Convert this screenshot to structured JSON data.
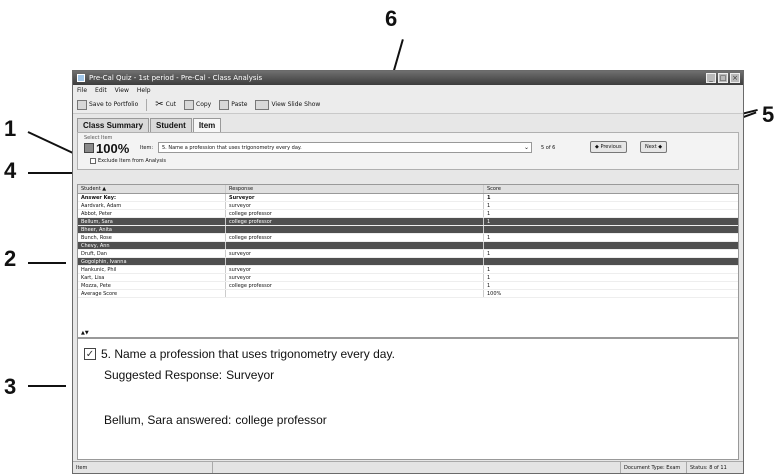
{
  "window": {
    "title": "Pre-Cal Quiz - 1st period - Pre-Cal - Class Analysis"
  },
  "menu": [
    "File",
    "Edit",
    "View",
    "Help"
  ],
  "toolbar": {
    "save": "Save to Portfolio",
    "cut": "Cut",
    "copy": "Copy",
    "paste": "Paste",
    "slideshow": "View Slide Show"
  },
  "tabs": [
    {
      "label": "Class Summary",
      "active": false
    },
    {
      "label": "Student",
      "active": false
    },
    {
      "label": "Item",
      "active": true
    }
  ],
  "item_panel": {
    "select_label": "Select Item",
    "percent": "100%",
    "item_label": "Item:",
    "item_value": "5. Name a profession that uses trigonometry every day.",
    "of_count": "5 of 6",
    "exclude_label": "Exclude Item from Analysis",
    "previous": "Previous",
    "next": "Next"
  },
  "grid": {
    "headers": [
      "Student",
      "Response",
      "Score"
    ],
    "rows": [
      {
        "student": "Answer Key:",
        "response": "Surveyor",
        "score": "1",
        "style": "bold"
      },
      {
        "student": "Aardvark, Adam",
        "response": "surveyor",
        "score": "1",
        "style": ""
      },
      {
        "student": "Abbot, Peter",
        "response": "college professor",
        "score": "1",
        "style": ""
      },
      {
        "student": "Bellum, Sara",
        "response": "college professor",
        "score": "1",
        "style": "sel"
      },
      {
        "student": "Bheer, Anita",
        "response": "",
        "score": "",
        "style": "sel"
      },
      {
        "student": "Bunch, Rose",
        "response": "college professor",
        "score": "1",
        "style": ""
      },
      {
        "student": "Chevy, Ann",
        "response": "",
        "score": "",
        "style": "sel"
      },
      {
        "student": "Druft, Dan",
        "response": "surveyor",
        "score": "1",
        "style": ""
      },
      {
        "student": "Gogolphin, Ivanna",
        "response": "",
        "score": "",
        "style": "sel"
      },
      {
        "student": "Hankunic, Phil",
        "response": "surveyor",
        "score": "1",
        "style": ""
      },
      {
        "student": "Kart, Lisa",
        "response": "surveyor",
        "score": "1",
        "style": ""
      },
      {
        "student": "Mozza, Pete",
        "response": "college professor",
        "score": "1",
        "style": ""
      },
      {
        "student": "Average Score",
        "response": "",
        "score": "100%",
        "style": ""
      }
    ]
  },
  "detail": {
    "question": "5. Name a profession that uses trigonometry every day.",
    "suggested_label": "Suggested Response:",
    "suggested_value": "Surveyor",
    "answered_label": "Bellum, Sara answered:",
    "answered_value": "college professor"
  },
  "statusbar": {
    "left": "Item",
    "doc_type": "Document Type: Exam",
    "status": "Status: 8 of 11"
  },
  "callouts": [
    "1",
    "2",
    "3",
    "4",
    "5",
    "6"
  ]
}
